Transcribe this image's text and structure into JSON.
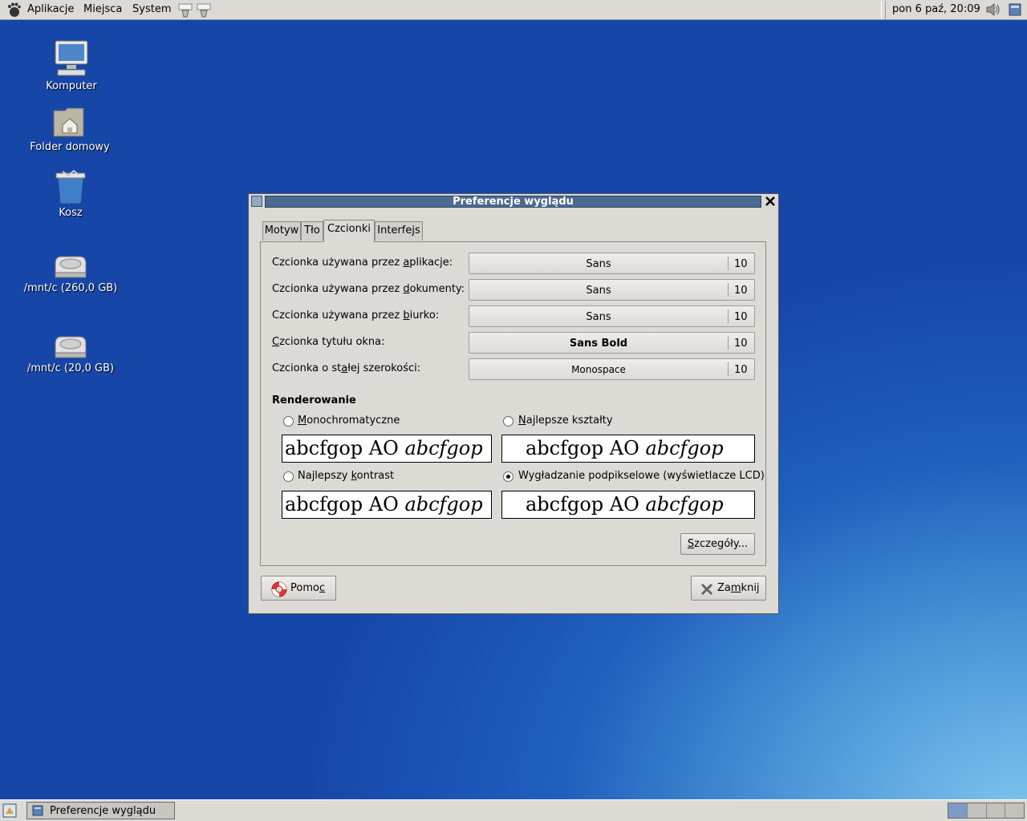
{
  "top_panel": {
    "menus": [
      "Aplikacje",
      "Miejsca",
      "System"
    ],
    "clock": "pon  6 paź, 20:09"
  },
  "desktop": {
    "icons": [
      {
        "label": "Komputer"
      },
      {
        "label": "Folder domowy"
      },
      {
        "label": "Kosz"
      },
      {
        "label": "/mnt/c (260,0 GB)"
      },
      {
        "label": "/mnt/c (20,0 GB)"
      }
    ]
  },
  "window": {
    "title": "Preferencje wyglądu",
    "tabs": [
      "Motyw",
      "Tło",
      "Czcionki",
      "Interfejs"
    ],
    "active_tab": "Czcionki",
    "fonts": [
      {
        "label_pre": "Czcionka używana przez ",
        "label_key": "a",
        "label_post": "plikacje:",
        "font": "Sans",
        "size": "10"
      },
      {
        "label_pre": "Czcionka używana przez ",
        "label_key": "d",
        "label_post": "okumenty:",
        "font": "Sans",
        "size": "10"
      },
      {
        "label_pre": "Czcionka używana przez ",
        "label_key": "b",
        "label_post": "iurko:",
        "font": "Sans",
        "size": "10"
      },
      {
        "label_pre": "",
        "label_key": "C",
        "label_post": "zcionka tytułu okna:",
        "font": "Sans Bold",
        "size": "10"
      },
      {
        "label_pre": "Czcionka o st",
        "label_key": "a",
        "label_post": "łej szerokości:",
        "font": "Monospace",
        "size": "10"
      }
    ],
    "rendering": {
      "heading": "Renderowanie",
      "options": [
        {
          "pre": "",
          "key": "M",
          "post": "onochromatyczne",
          "selected": false
        },
        {
          "pre": "",
          "key": "N",
          "post": "ajlepsze kształty",
          "selected": false
        },
        {
          "pre": "Najlepszy ",
          "key": "k",
          "post": "ontrast",
          "selected": false
        },
        {
          "pre": "Wy",
          "key": "g",
          "post": "ładzanie podpikselowe (wyświetlacze LCD)",
          "selected": true
        }
      ],
      "sample_regular": "abcfgop AO ",
      "sample_italic": "abcfgop"
    },
    "details_button": {
      "key": "S",
      "post": "zczegóły..."
    },
    "help_button": {
      "pre": "Pomo",
      "key": "c"
    },
    "close_button": {
      "pre": "Za",
      "key": "m",
      "post": "knij"
    }
  },
  "bottom_panel": {
    "task": "Preferencje wyglądu"
  },
  "colors": {
    "titlebar": "#4d6a8f",
    "panel": "#dcdad5"
  }
}
